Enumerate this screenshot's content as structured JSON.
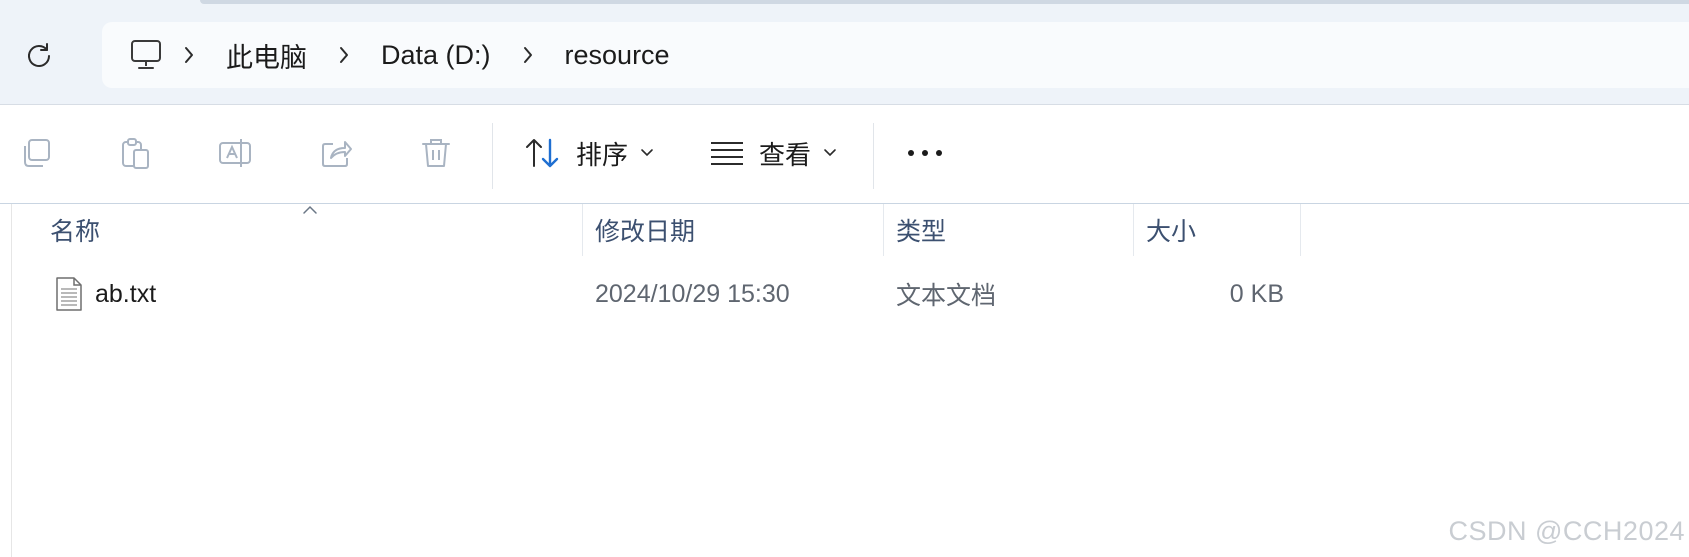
{
  "address": {
    "refresh_icon": "refresh-icon",
    "pc_icon": "computer-icon",
    "breadcrumbs": [
      "此电脑",
      "Data (D:)",
      "resource"
    ]
  },
  "toolbar": {
    "icons": [
      "copy-icon",
      "paste-icon",
      "rename-icon",
      "share-icon",
      "delete-icon"
    ],
    "sort_label": "排序",
    "view_label": "查看",
    "more_icon": "more-icon"
  },
  "columns": {
    "name": "名称",
    "modified": "修改日期",
    "type": "类型",
    "size": "大小"
  },
  "files": [
    {
      "name": "ab.txt",
      "modified": "2024/10/29 15:30",
      "type": "文本文档",
      "size": "0 KB",
      "icon": "text-file-icon"
    }
  ],
  "watermark": "CSDN @CCH2024",
  "colors": {
    "accent": "#1f6fd1",
    "header_bg": "#eef3f9",
    "column_text": "#3c5070",
    "disabled_icon": "#a9b4c2"
  }
}
